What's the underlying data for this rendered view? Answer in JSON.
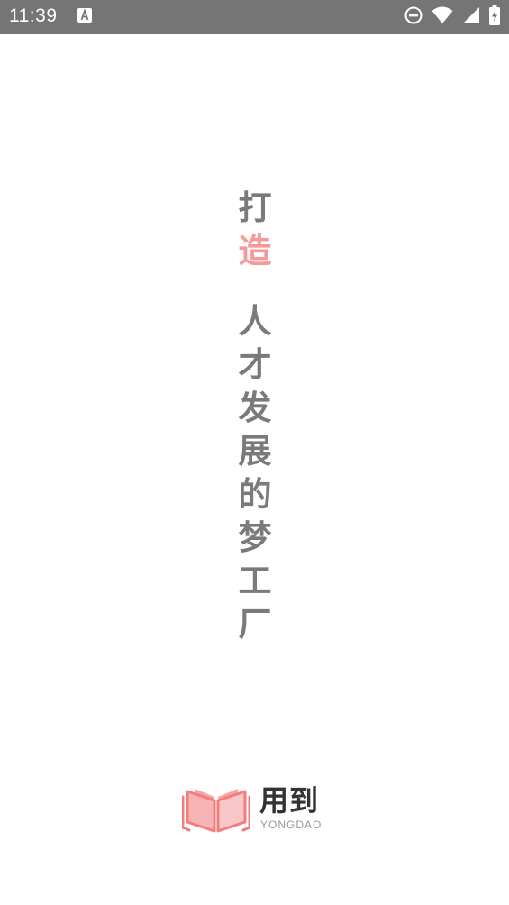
{
  "status_bar": {
    "time": "11:39",
    "notification_icon": "text-a-icon",
    "icons": [
      "do-not-disturb-icon",
      "wifi-icon",
      "cell-signal-icon",
      "battery-charging-icon"
    ],
    "background": "#757575"
  },
  "slogan": {
    "chars": [
      "打",
      "造",
      "人",
      "才",
      "发",
      "展",
      "的",
      "梦",
      "工",
      "厂"
    ],
    "text_color": "#7a7a7a",
    "accent_color": "#f59a9a"
  },
  "logo": {
    "title": "用到",
    "subtitle": "YONGDAO",
    "mark_icon": "open-book-icon",
    "mark_color": "#f47c7c"
  }
}
